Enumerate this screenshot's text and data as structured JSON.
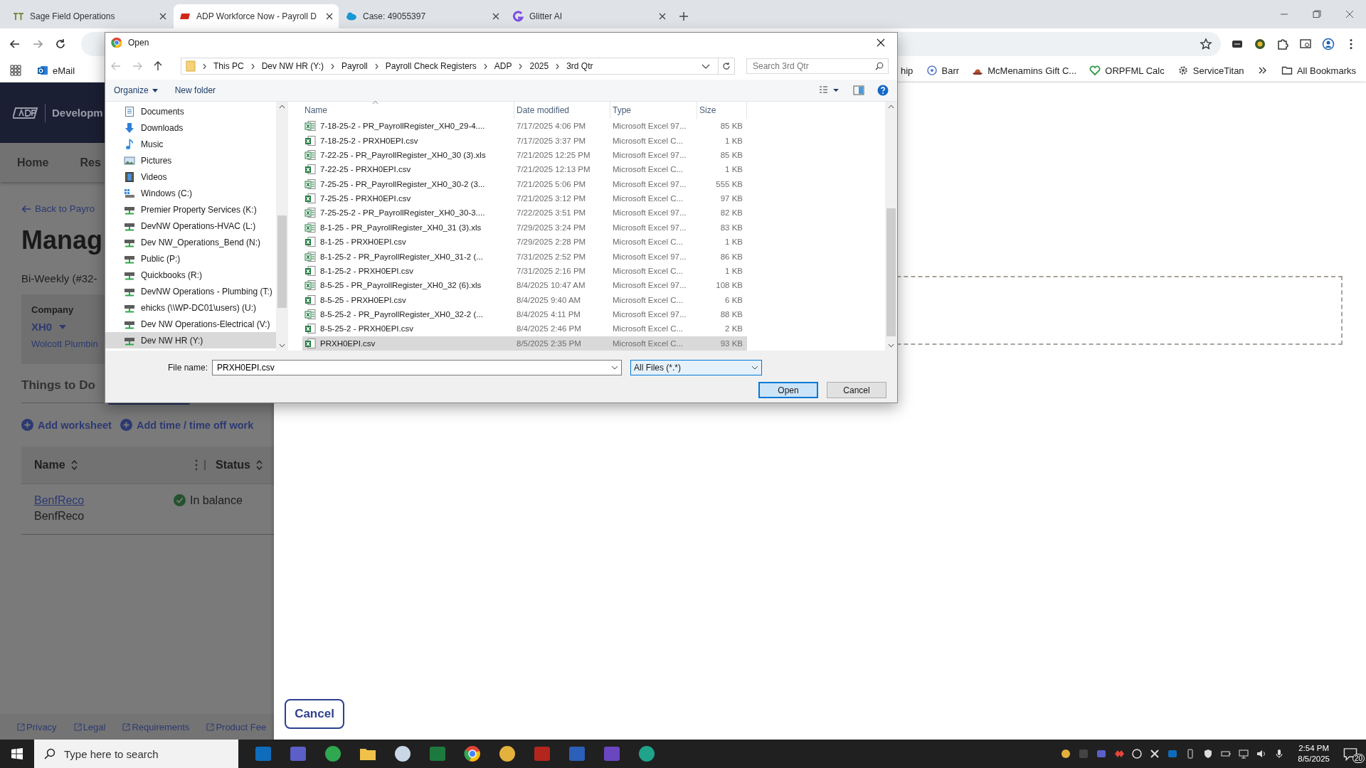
{
  "browser": {
    "tabs": [
      {
        "title": "Sage Field Operations",
        "kind": "tt",
        "selected": false
      },
      {
        "title": "ADP Workforce Now - Payroll D",
        "kind": "adp",
        "selected": true
      },
      {
        "title": "Case: 49055397",
        "kind": "cloud",
        "selected": false
      },
      {
        "title": "Glitter AI",
        "kind": "glitter",
        "selected": false
      }
    ],
    "bookmarks_left": [
      {
        "label": "eMail",
        "kind": "mail"
      }
    ],
    "bookmarks_right": [
      {
        "label": "hip",
        "kind": "none"
      },
      {
        "label": "Barr",
        "kind": "ring"
      },
      {
        "label": "McMenamins Gift C...",
        "kind": "hat"
      },
      {
        "label": "ORPFML Calc",
        "kind": "heart"
      },
      {
        "label": "ServiceTitan",
        "kind": "gear"
      }
    ],
    "all_bookmarks": "All Bookmarks"
  },
  "page": {
    "header_title": "Developm",
    "nav": [
      "Home",
      "Res"
    ],
    "back_link": "Back to Payro",
    "heading": "Manag",
    "subtitle": "Bi-Weekly (#32-",
    "company": {
      "label": "Company",
      "code": "XH0",
      "name": "Wolcott Plumbin"
    },
    "tab": "Things to Do",
    "actions": [
      "Add worksheet",
      "Add time / time off work"
    ],
    "table": {
      "columns": [
        "Name",
        "Status"
      ],
      "rows": [
        {
          "link": "BenfReco",
          "name": "BenfReco",
          "status": "In balance"
        }
      ]
    },
    "footer_links": [
      "Privacy",
      "Legal",
      "Requirements",
      "Product Fee"
    ],
    "modal_cancel": "Cancel"
  },
  "dialog": {
    "title": "Open",
    "breadcrumb": [
      "This PC",
      "Dev NW HR (Y:)",
      "Payroll",
      "Payroll Check Registers",
      "ADP",
      "2025",
      "3rd Qtr"
    ],
    "search_placeholder": "Search 3rd Qtr",
    "commands": [
      "Organize",
      "New folder"
    ],
    "nav_items": [
      {
        "label": "Documents",
        "kind": "documents",
        "selected": false
      },
      {
        "label": "Downloads",
        "kind": "downloads",
        "selected": false
      },
      {
        "label": "Music",
        "kind": "music",
        "selected": false
      },
      {
        "label": "Pictures",
        "kind": "pictures",
        "selected": false
      },
      {
        "label": "Videos",
        "kind": "videos",
        "selected": false
      },
      {
        "label": "Windows (C:)",
        "kind": "windows",
        "selected": false
      },
      {
        "label": "Premier Property Services (K:)",
        "kind": "drive",
        "selected": false
      },
      {
        "label": "DevNW Operations-HVAC (L:)",
        "kind": "drive",
        "selected": false
      },
      {
        "label": "Dev NW_Operations_Bend (N:)",
        "kind": "drive",
        "selected": false
      },
      {
        "label": "Public (P:)",
        "kind": "drive",
        "selected": false
      },
      {
        "label": "Quickbooks (R:)",
        "kind": "drive",
        "selected": false
      },
      {
        "label": "DevNW Operations - Plumbing (T:)",
        "kind": "drive",
        "selected": false
      },
      {
        "label": "ehicks (\\\\WP-DC01\\users) (U:)",
        "kind": "drive",
        "selected": false
      },
      {
        "label": "Dev NW Operations-Electrical (V:)",
        "kind": "drive",
        "selected": false
      },
      {
        "label": "Dev NW HR (Y:)",
        "kind": "drive",
        "selected": true
      }
    ],
    "columns": [
      "Name",
      "Date modified",
      "Type",
      "Size"
    ],
    "files": [
      {
        "name": "7-18-25-2 - PR_PayrollRegister_XH0_29-4....",
        "date": "7/17/2025 4:06 PM",
        "type": "Microsoft Excel 97...",
        "size": "85 KB",
        "kind": "xls",
        "selected": false
      },
      {
        "name": "7-18-25-2 - PRXH0EPI.csv",
        "date": "7/17/2025 3:37 PM",
        "type": "Microsoft Excel C...",
        "size": "1 KB",
        "kind": "csv",
        "selected": false
      },
      {
        "name": "7-22-25 - PR_PayrollRegister_XH0_30 (3).xls",
        "date": "7/21/2025 12:25 PM",
        "type": "Microsoft Excel 97...",
        "size": "85 KB",
        "kind": "xls",
        "selected": false
      },
      {
        "name": "7-22-25 - PRXH0EPI.csv",
        "date": "7/21/2025 12:13 PM",
        "type": "Microsoft Excel C...",
        "size": "1 KB",
        "kind": "csv",
        "selected": false
      },
      {
        "name": "7-25-25 - PR_PayrollRegister_XH0_30-2 (3...",
        "date": "7/21/2025 5:06 PM",
        "type": "Microsoft Excel 97...",
        "size": "555 KB",
        "kind": "xls",
        "selected": false
      },
      {
        "name": "7-25-25 - PRXH0EPI.csv",
        "date": "7/21/2025 3:12 PM",
        "type": "Microsoft Excel C...",
        "size": "97 KB",
        "kind": "csv",
        "selected": false
      },
      {
        "name": "7-25-25-2 - PR_PayrollRegister_XH0_30-3....",
        "date": "7/22/2025 3:51 PM",
        "type": "Microsoft Excel 97...",
        "size": "82 KB",
        "kind": "xls",
        "selected": false
      },
      {
        "name": "8-1-25 - PR_PayrollRegister_XH0_31 (3).xls",
        "date": "7/29/2025 3:24 PM",
        "type": "Microsoft Excel 97...",
        "size": "83 KB",
        "kind": "xls",
        "selected": false
      },
      {
        "name": "8-1-25 - PRXH0EPI.csv",
        "date": "7/29/2025 2:28 PM",
        "type": "Microsoft Excel C...",
        "size": "1 KB",
        "kind": "csv",
        "selected": false
      },
      {
        "name": "8-1-25-2 - PR_PayrollRegister_XH0_31-2 (...",
        "date": "7/31/2025 2:52 PM",
        "type": "Microsoft Excel 97...",
        "size": "86 KB",
        "kind": "xls",
        "selected": false
      },
      {
        "name": "8-1-25-2 - PRXH0EPI.csv",
        "date": "7/31/2025 2:16 PM",
        "type": "Microsoft Excel C...",
        "size": "1 KB",
        "kind": "csv",
        "selected": false
      },
      {
        "name": "8-5-25 - PR_PayrollRegister_XH0_32 (6).xls",
        "date": "8/4/2025 10:47 AM",
        "type": "Microsoft Excel 97...",
        "size": "108 KB",
        "kind": "xls",
        "selected": false
      },
      {
        "name": "8-5-25 - PRXH0EPI.csv",
        "date": "8/4/2025 9:40 AM",
        "type": "Microsoft Excel C...",
        "size": "6 KB",
        "kind": "csv",
        "selected": false
      },
      {
        "name": "8-5-25-2 - PR_PayrollRegister_XH0_32-2 (...",
        "date": "8/4/2025 4:11 PM",
        "type": "Microsoft Excel 97...",
        "size": "88 KB",
        "kind": "xls",
        "selected": false
      },
      {
        "name": "8-5-25-2 - PRXH0EPI.csv",
        "date": "8/4/2025 2:46 PM",
        "type": "Microsoft Excel C...",
        "size": "2 KB",
        "kind": "csv",
        "selected": false
      },
      {
        "name": "PRXH0EPI.csv",
        "date": "8/5/2025 2:35 PM",
        "type": "Microsoft Excel C...",
        "size": "93 KB",
        "kind": "csv",
        "selected": true
      }
    ],
    "file_name_label": "File name:",
    "file_name": "PRXH0EPI.csv",
    "file_type": "All Files (*.*)",
    "buttons": [
      "Open",
      "Cancel"
    ]
  },
  "taskbar": {
    "search_placeholder": "Type here to search",
    "time": "2:54 PM",
    "date": "8/5/2025",
    "notifications": "20"
  }
}
